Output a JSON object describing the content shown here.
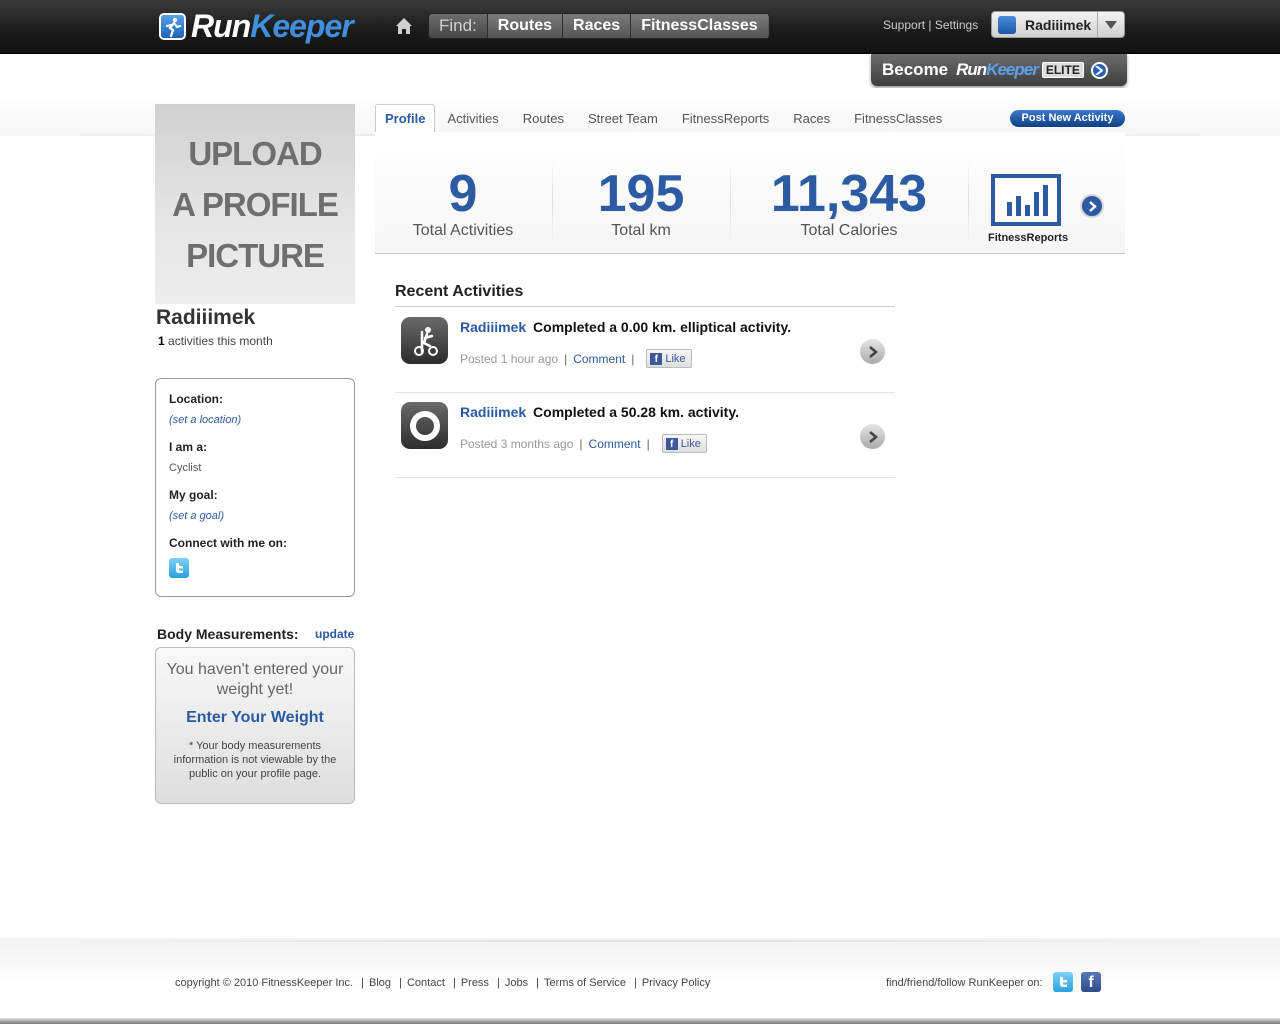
{
  "header": {
    "logo_part1": "Run",
    "logo_part2": "Keeper",
    "find_label": "Find:",
    "find_items": [
      "Routes",
      "Races",
      "FitnessClasses"
    ],
    "support_label": "Support",
    "settings_label": "Settings",
    "username": "Radiiimek"
  },
  "elite": {
    "become_label": "Become",
    "brand_part1": "Run",
    "brand_part2": "Keeper",
    "elite_label": "ELITE"
  },
  "profile": {
    "upload_lines": [
      "UPLOAD",
      "A PROFILE",
      "PICTURE"
    ],
    "name": "Radiiimek",
    "month_count": "1",
    "month_suffix": "activities this month",
    "location_label": "Location:",
    "location_link": "(set a location)",
    "iam_label": "I am a:",
    "iam_value": "Cyclist",
    "goal_label": "My goal:",
    "goal_link": "(set a goal)",
    "connect_label": "Connect with me on:"
  },
  "body_measurements": {
    "title": "Body Measurements:",
    "update_label": "update",
    "message": "You haven't entered your weight yet!",
    "enter_link": "Enter Your Weight",
    "note": "* Your body measurements information is not viewable by the public on your profile page."
  },
  "tabs": [
    "Profile",
    "Activities",
    "Routes",
    "Street Team",
    "FitnessReports",
    "Races",
    "FitnessClasses"
  ],
  "post_button": "Post New Activity",
  "stats": [
    {
      "value": "9",
      "label": "Total Activities"
    },
    {
      "value": "195",
      "label": "Total km"
    },
    {
      "value": "11,343",
      "label": "Total Calories"
    }
  ],
  "fitness_reports_label": "FitnessReports",
  "recent": {
    "title": "Recent Activities",
    "items": [
      {
        "user": "Radiiimek",
        "text": "Completed a 0.00 km. elliptical activity.",
        "posted": "Posted 1 hour ago",
        "comment": "Comment",
        "like": "Like",
        "icon": "elliptical-icon"
      },
      {
        "user": "Radiiimek",
        "text": "Completed a 50.28 km. activity.",
        "posted": "Posted 3 months ago",
        "comment": "Comment",
        "like": "Like",
        "icon": "generic-activity-icon"
      }
    ]
  },
  "footer": {
    "copyright": "copyright © 2010 FitnessKeeper Inc.",
    "links": [
      "Blog",
      "Contact",
      "Press",
      "Jobs",
      "Terms of Service",
      "Privacy Policy"
    ],
    "follow": "find/friend/follow RunKeeper on:"
  },
  "colors": {
    "accent_blue": "#2c5ba3",
    "link_blue": "#2a5aa0",
    "topbar": "#1c1c1c"
  }
}
